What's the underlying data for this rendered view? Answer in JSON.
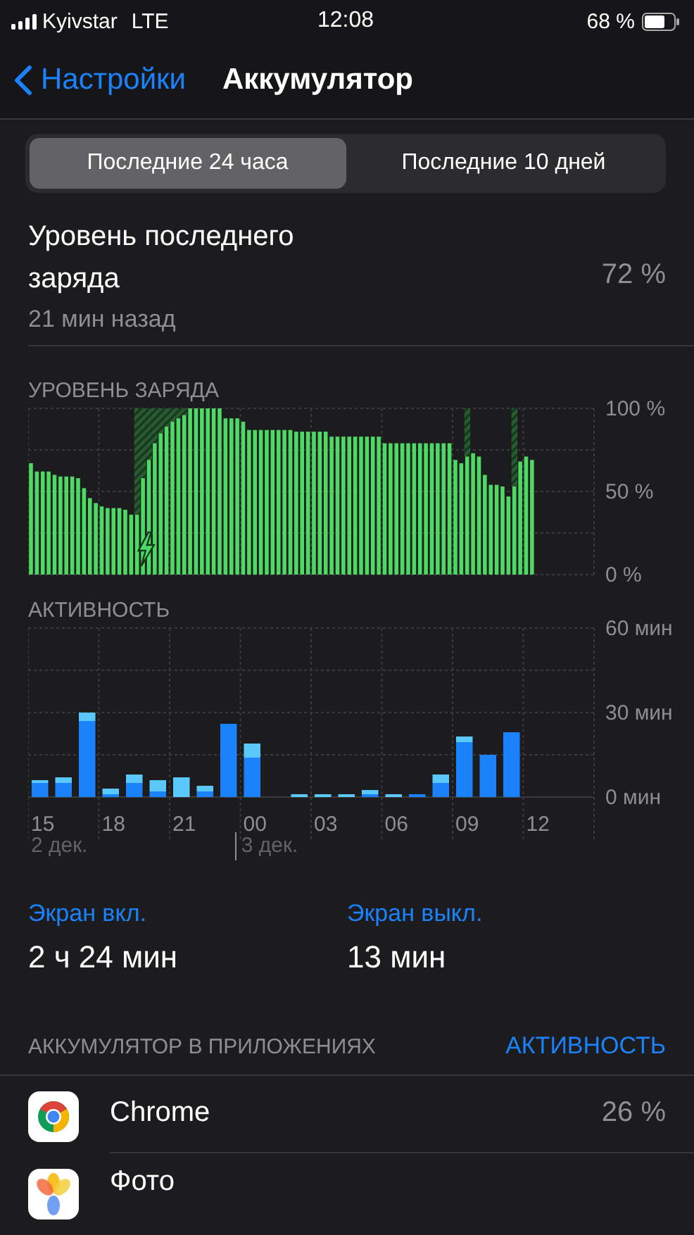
{
  "status": {
    "carrier": "Kyivstar",
    "network": "LTE",
    "time": "12:08",
    "battery": "68 %"
  },
  "nav": {
    "back": "Настройки",
    "title": "Аккумулятор"
  },
  "segments": [
    {
      "label": "Последние 24 часа",
      "selected": true
    },
    {
      "label": "Последние 10 дней",
      "selected": false
    }
  ],
  "last_charge": {
    "label": "Уровень последнего заряда",
    "time": "21 мин назад",
    "value": "72 %"
  },
  "battery_level": {
    "title": "УРОВЕНЬ ЗАРЯДА",
    "chart_data": {
      "type": "bar",
      "ylim": [
        0,
        100
      ],
      "yticks": [
        {
          "value": 0,
          "label": "0 %"
        },
        {
          "value": 50,
          "label": "50 %"
        },
        {
          "value": 100,
          "label": "100 %"
        }
      ],
      "stacked": true,
      "grid": true,
      "series": [
        {
          "color": "#4cd964",
          "values": [
            67,
            62,
            62,
            62,
            60,
            59,
            59,
            59,
            58,
            52,
            46,
            43,
            41,
            40,
            40,
            40,
            39,
            36,
            36,
            58,
            69,
            79,
            85,
            89,
            92,
            94,
            96,
            100,
            100,
            100,
            100,
            100,
            100,
            94,
            94,
            94,
            92,
            87,
            87,
            87,
            87,
            87,
            87,
            87,
            87,
            86,
            86,
            86,
            86,
            86,
            86,
            83,
            83,
            83,
            83,
            83,
            83,
            83,
            83,
            83,
            79,
            79,
            79,
            79,
            79,
            79,
            79,
            79,
            79,
            79,
            79,
            79,
            69,
            67,
            71,
            73,
            71,
            60,
            54,
            54,
            53,
            47,
            53,
            68,
            71,
            69,
            null,
            null,
            null,
            null,
            null,
            null,
            null,
            null,
            null,
            null
          ]
        },
        {
          "color": "#2b5a32",
          "values": [
            null,
            null,
            null,
            null,
            null,
            null,
            null,
            null,
            null,
            null,
            null,
            null,
            null,
            null,
            null,
            null,
            null,
            null,
            64,
            42,
            31,
            21,
            15,
            11,
            8,
            6,
            4,
            null,
            null,
            null,
            null,
            null,
            null,
            null,
            null,
            null,
            null,
            null,
            null,
            null,
            null,
            null,
            null,
            null,
            null,
            null,
            null,
            null,
            null,
            null,
            null,
            null,
            null,
            null,
            null,
            null,
            null,
            null,
            null,
            null,
            null,
            null,
            null,
            null,
            null,
            null,
            null,
            null,
            null,
            null,
            null,
            null,
            null,
            null,
            29,
            null,
            null,
            null,
            null,
            null,
            null,
            null,
            47,
            null,
            null,
            null,
            null,
            null,
            null,
            null,
            null,
            null,
            null,
            null,
            null,
            null
          ]
        }
      ]
    }
  },
  "activity": {
    "title": "АКТИВНОСТЬ",
    "chart_data": {
      "type": "bar",
      "stacked": true,
      "grid": true,
      "ylim": [
        0,
        60
      ],
      "categories": [
        "15",
        null,
        null,
        "18",
        null,
        null,
        "21",
        null,
        null,
        "00",
        null,
        null,
        "03",
        null,
        null,
        "06",
        null,
        null,
        "09",
        null,
        null,
        "12",
        null,
        null
      ],
      "yticks": [
        {
          "value": 0,
          "label": "0 мин"
        },
        {
          "value": 30,
          "label": "30 мин"
        },
        {
          "value": 60,
          "label": "60 мин"
        }
      ],
      "series": [
        {
          "color": "#1a82fb",
          "values": [
            5,
            5,
            27,
            1,
            5,
            2,
            0,
            2,
            26,
            14,
            null,
            0,
            0,
            0,
            1,
            0,
            1,
            5,
            19.5,
            15,
            23,
            null,
            null,
            null
          ]
        },
        {
          "color": "#5ac8fa",
          "values": [
            1,
            2,
            3,
            2,
            3,
            4,
            7,
            2,
            0,
            5,
            null,
            1,
            1,
            1,
            1.5,
            1,
            0,
            3,
            2,
            0,
            0,
            null,
            null,
            null
          ]
        }
      ]
    },
    "dates": [
      "2 дек.",
      "3 дек."
    ]
  },
  "screen": [
    {
      "label": "Экран вкл.",
      "value": "2 ч 24 мин"
    },
    {
      "label": "Экран выкл.",
      "value": "13 мин"
    }
  ],
  "apps_header": {
    "title": "АККУМУЛЯТОР В ПРИЛОЖЕНИЯХ",
    "action": "АКТИВНОСТЬ"
  },
  "apps": [
    {
      "kind": "chrome",
      "name": "Chrome",
      "percent": "26 %"
    },
    {
      "kind": "photos",
      "name": "Фото"
    }
  ]
}
